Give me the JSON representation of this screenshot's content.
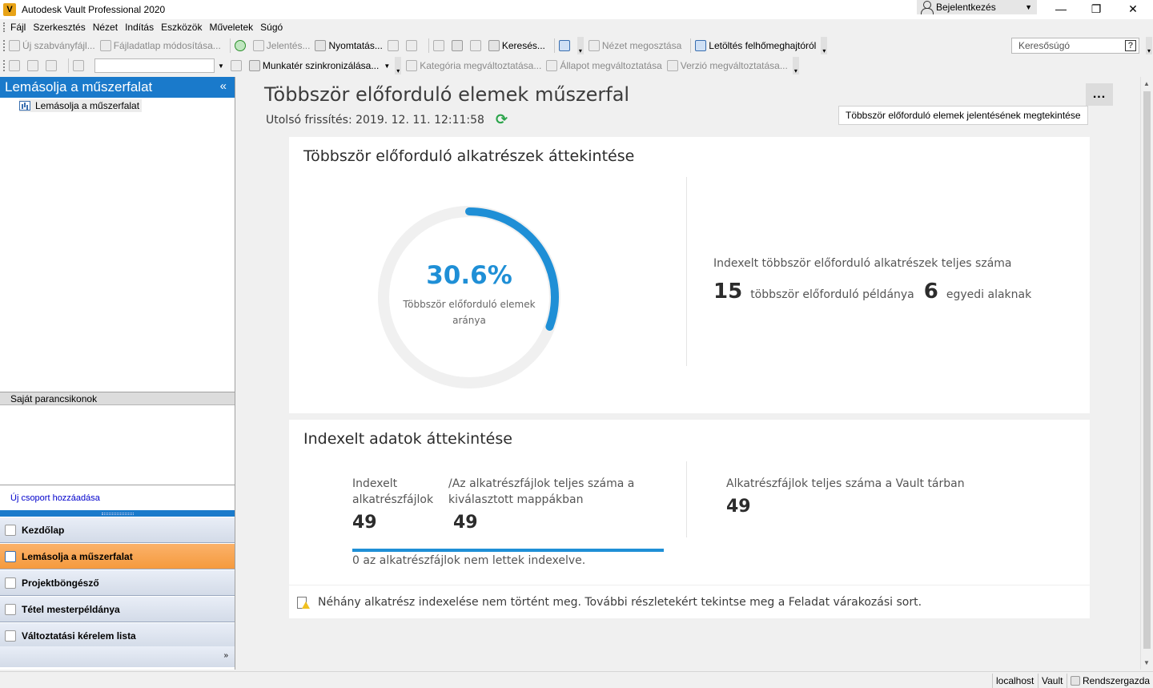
{
  "window": {
    "title": "Autodesk Vault Professional 2020",
    "login_label": "Bejelentkezés",
    "minimize": "—",
    "restore": "❐",
    "close": "✕"
  },
  "menu": [
    "Fájl",
    "Szerkesztés",
    "Nézet",
    "Indítás",
    "Eszközök",
    "Műveletek",
    "Súgó"
  ],
  "toolbar1": {
    "new_file": "Új szabványfájl...",
    "edit_datasheet": "Fájladatlap módosítása...",
    "report": "Jelentés...",
    "print": "Nyomtatás...",
    "search": "Keresés...",
    "share_view": "Nézet megosztása",
    "download": "Letöltés felhőmeghajtóról"
  },
  "toolbar2": {
    "sync_workspace": "Munkatér szinkronizálása...",
    "change_category": "Kategória megváltoztatása...",
    "change_state": "Állapot megváltoztatása",
    "change_revision": "Verzió megváltoztatása..."
  },
  "search_help": {
    "placeholder": "Keresősúgó",
    "help_glyph": "?"
  },
  "left_panel": {
    "header": "Lemásolja a műszerfalat",
    "collapse_glyph": "«",
    "tree_item": "Lemásolja a műszerfalat",
    "shortcuts_header": "Saját parancsikonok",
    "add_group": "Új csoport hozzáadása",
    "nav": [
      {
        "label": "Kezdőlap",
        "active": false
      },
      {
        "label": "Lemásolja a műszerfalat",
        "active": true
      },
      {
        "label": "Projektböngésző",
        "active": false
      },
      {
        "label": "Tétel mesterpéldánya",
        "active": false
      },
      {
        "label": "Változtatási kérelem lista",
        "active": false
      }
    ],
    "more_glyph": "»"
  },
  "dashboard": {
    "title": "Többször előforduló elemek műszerfal",
    "last_refresh": "Utolsó frissítés: 2019. 12. 11. 12:11:58",
    "more_glyph": "...",
    "tooltip": "Többször előforduló elemek jelentésének megtekintése",
    "overview": {
      "title": "Többször előforduló alkatrészek áttekintése",
      "ratio_text": "30.6%",
      "ratio_value": 0.306,
      "ratio_label": "Többször előforduló elemek aránya",
      "total_label": "Indexelt többször előforduló alkatrészek teljes száma",
      "instances": "15",
      "instances_label": "többször előforduló példánya",
      "unique": "6",
      "unique_label": "egyedi alaknak"
    },
    "indexed": {
      "title": "Indexelt adatok áttekintése",
      "indexed_label": "Indexelt alkatrészfájlok",
      "indexed_value": "49",
      "total_selected_label": "/Az alkatrészfájlok teljes száma a kiválasztott mappákban",
      "total_selected_value": "49",
      "progress_fraction": 1.0,
      "not_indexed_note": "0  az alkatrészfájlok nem lettek indexelve.",
      "vault_total_label": "Alkatrészfájlok teljes száma a Vault tárban",
      "vault_total_value": "49",
      "warning": "Néhány alkatrész indexelése nem történt meg. További részletekért tekintse meg a Feladat várakozási sort."
    }
  },
  "colors": {
    "accent": "#1f8fd6",
    "header_blue": "#1a7acb",
    "active_nav": "#f59a3e",
    "refresh_green": "#2aa44a"
  },
  "statusbar": {
    "server": "localhost",
    "vault": "Vault",
    "user": "Rendszergazda"
  }
}
